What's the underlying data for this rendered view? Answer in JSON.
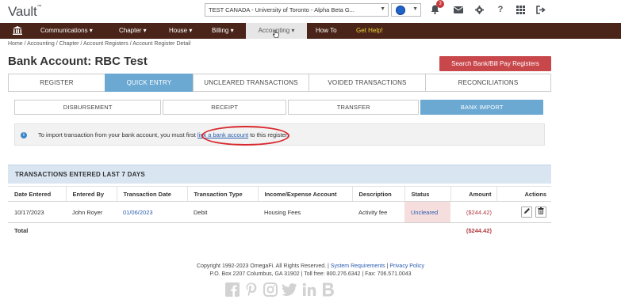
{
  "app": {
    "logo": "Vault",
    "logo_mark": "™"
  },
  "header": {
    "org_select": "TEST CANADA - University of Toronto - Alpha Beta G...",
    "notification_count": "3"
  },
  "nav": {
    "items": [
      {
        "label": "Communications ▾"
      },
      {
        "label": "Chapter ▾"
      },
      {
        "label": "House ▾"
      },
      {
        "label": "Billing ▾"
      },
      {
        "label": "Accounting ▾"
      },
      {
        "label": "How To"
      },
      {
        "label": "Get Help!"
      }
    ]
  },
  "breadcrumb": "Home / Accounting / Chapter / Account Registers / Account Register Detail",
  "page": {
    "title": "Bank Account: RBC Test",
    "search_button": "Search Bank/Bill Pay Registers"
  },
  "tabs": [
    "REGISTER",
    "QUICK ENTRY",
    "UNCLEARED TRANSACTIONS",
    "VOIDED TRANSACTIONS",
    "RECONCILIATIONS"
  ],
  "subtabs": [
    "DISBURSEMENT",
    "RECEIPT",
    "TRANSFER",
    "BANK IMPORT"
  ],
  "info": {
    "before": "To import transaction from your bank account, you must first ",
    "link": "link a bank account",
    "after": " to this register."
  },
  "transactions": {
    "heading": "TRANSACTIONS ENTERED LAST 7 DAYS",
    "columns": [
      "Date Entered",
      "Entered By",
      "Transaction Date",
      "Transaction Type",
      "Income/Expense Account",
      "Description",
      "Status",
      "Amount",
      "Actions"
    ],
    "rows": [
      {
        "date_entered": "10/17/2023",
        "entered_by": "John Royer",
        "transaction_date": "01/06/2023",
        "type": "Debit",
        "account": "Housing Fees",
        "description": "Activity fee",
        "status": "Uncleared",
        "amount": "($244.42)"
      }
    ],
    "total_label": "Total",
    "total_amount": "($244.42)"
  },
  "footer": {
    "copyright": "Copyright 1992-2023 OmegaFi. All Rights Reserved. | ",
    "system_requirements": "System Requirements",
    "separator": " | ",
    "privacy": "Privacy Policy",
    "address": "P.O. Box 2207 Columbus, GA 31902 | Toll free: 800.276.6342 | Fax: 706.571.0043"
  }
}
